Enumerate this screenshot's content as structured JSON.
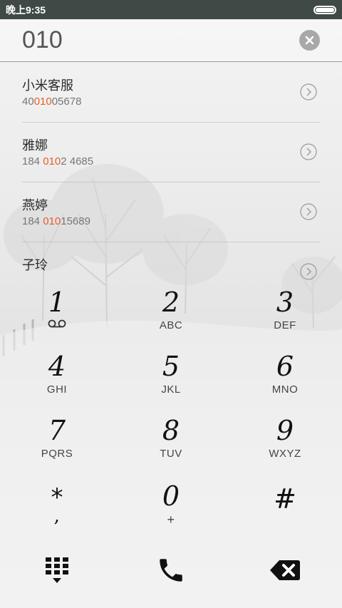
{
  "status_bar": {
    "time": "晚上9:35",
    "battery_level": 1.0
  },
  "search": {
    "value": "010",
    "clear_icon": "close-icon"
  },
  "results": [
    {
      "name": "小米客服",
      "number_pre": "40",
      "number_match": "010",
      "number_post": "05678"
    },
    {
      "name": "雅娜",
      "number_pre": "184 ",
      "number_match": "010",
      "number_post": "2 4685"
    },
    {
      "name": "燕婷",
      "number_pre": "184 ",
      "number_match": "010",
      "number_post": "15689"
    },
    {
      "name": "子玲",
      "number_pre": "",
      "number_match": "",
      "number_post": ""
    }
  ],
  "keypad": {
    "k1": {
      "digit": "1",
      "icon": "voicemail-icon"
    },
    "k2": {
      "digit": "2",
      "letters": "ABC"
    },
    "k3": {
      "digit": "3",
      "letters": "DEF"
    },
    "k4": {
      "digit": "4",
      "letters": "GHI"
    },
    "k5": {
      "digit": "5",
      "letters": "JKL"
    },
    "k6": {
      "digit": "6",
      "letters": "MNO"
    },
    "k7": {
      "digit": "7",
      "letters": "PQRS"
    },
    "k8": {
      "digit": "8",
      "letters": "TUV"
    },
    "k9": {
      "digit": "9",
      "letters": "WXYZ"
    },
    "kstar": {
      "digit": "*",
      "letters": ","
    },
    "k0": {
      "digit": "0",
      "letters": "+"
    },
    "khash": {
      "digit": "#",
      "letters": ""
    }
  },
  "bottom": {
    "left_icon": "dialpad-toggle-icon",
    "center_icon": "phone-call-icon",
    "right_icon": "backspace-icon"
  },
  "colors": {
    "status_bar": "#3f4a47",
    "match_highlight": "#e85d2a"
  }
}
